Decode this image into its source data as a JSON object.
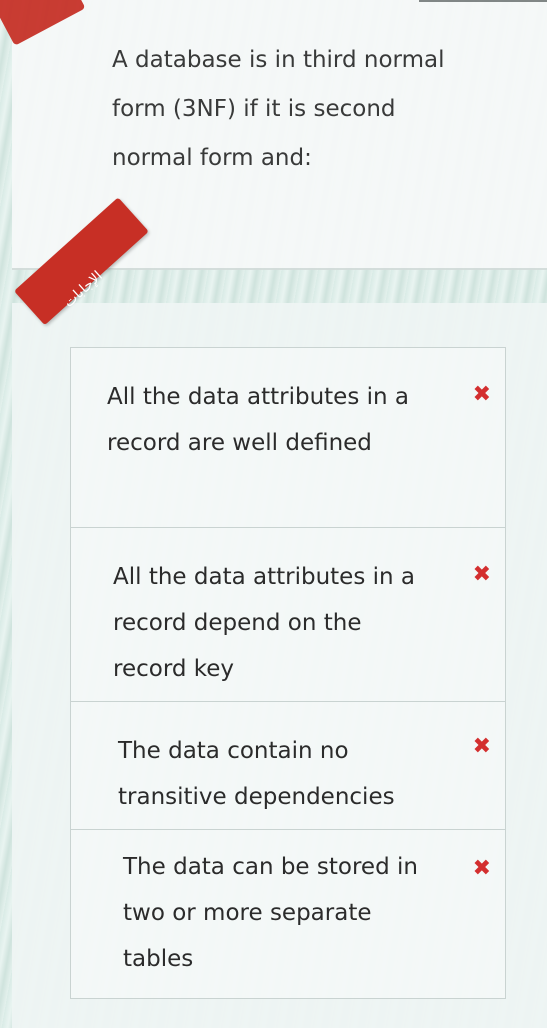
{
  "question": {
    "text": "A database is in third normal form (3NF) if it is second normal form and:"
  },
  "answers_panel": {
    "ribbon_label": "الإجابات"
  },
  "options": [
    {
      "text": "All the data attributes in a record are well defined",
      "mark": "✖",
      "status": "incorrect"
    },
    {
      "text": "All the data attributes in a record depend on the record key",
      "mark": "✖",
      "status": "incorrect"
    },
    {
      "text": "The data contain no transitive dependencies",
      "mark": "✖",
      "status": "incorrect"
    },
    {
      "text": "The data can be stored in two or more separate tables",
      "mark": "✖",
      "status": "incorrect"
    }
  ],
  "colors": {
    "accent_red": "#c72f25",
    "x_mark_red": "#d32f2f"
  }
}
